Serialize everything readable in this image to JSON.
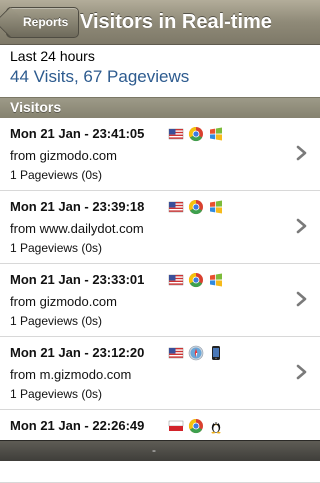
{
  "navbar": {
    "back_label": "Reports",
    "title": "Visitors in Real-time"
  },
  "summary": {
    "label": "Last 24 hours",
    "value": "44 Visits, 67 Pageviews"
  },
  "section": {
    "title": "Visitors"
  },
  "rows": [
    {
      "time": "Mon 21 Jan - 23:41:05",
      "referrer": "from gizmodo.com",
      "pageviews": "1 Pageviews (0s)",
      "icons": [
        "us-flag-icon",
        "chrome-icon",
        "windows-icon"
      ]
    },
    {
      "time": "Mon 21 Jan - 23:39:18",
      "referrer": "from www.dailydot.com",
      "pageviews": "1 Pageviews (0s)",
      "icons": [
        "us-flag-icon",
        "chrome-icon",
        "windows-icon"
      ]
    },
    {
      "time": "Mon 21 Jan - 23:33:01",
      "referrer": "from gizmodo.com",
      "pageviews": "1 Pageviews (0s)",
      "icons": [
        "us-flag-icon",
        "chrome-icon",
        "windows-icon"
      ]
    },
    {
      "time": "Mon 21 Jan - 23:12:20",
      "referrer": "from m.gizmodo.com",
      "pageviews": "1 Pageviews (0s)",
      "icons": [
        "us-flag-icon",
        "safari-icon",
        "iphone-icon"
      ]
    },
    {
      "time": "Mon 21 Jan - 22:26:49",
      "referrer": "",
      "pageviews": "",
      "icons": [
        "poland-flag-icon",
        "chrome-icon",
        "linux-icon"
      ]
    }
  ],
  "bottom": {
    "label": "-"
  }
}
